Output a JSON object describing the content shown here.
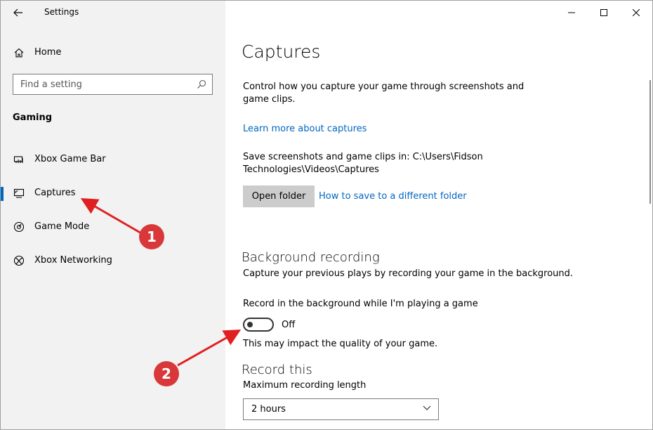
{
  "titlebar": {
    "app_title": "Settings"
  },
  "sidebar": {
    "home_label": "Home",
    "search_placeholder": "Find a setting",
    "section_title": "Gaming",
    "items": [
      {
        "label": "Xbox Game Bar",
        "icon": "xbox-game-bar-icon"
      },
      {
        "label": "Captures",
        "icon": "captures-icon",
        "active": true
      },
      {
        "label": "Game Mode",
        "icon": "game-mode-icon"
      },
      {
        "label": "Xbox Networking",
        "icon": "xbox-icon"
      }
    ]
  },
  "main": {
    "title": "Captures",
    "description": "Control how you capture your game through screenshots and game clips.",
    "learn_more_link": "Learn more about captures",
    "save_path_text": "Save screenshots and game clips in: C:\\Users\\Fidson Technologies\\Videos\\Captures",
    "open_folder_label": "Open folder",
    "how_to_link": "How to save to a different folder",
    "background_recording": {
      "title": "Background recording",
      "description": "Capture your previous plays by recording your game in the background.",
      "toggle_label": "Record in the background while I'm playing a game",
      "toggle_state": "Off",
      "impact_note": "This may impact the quality of your game."
    },
    "record_this": {
      "title": "Record this",
      "max_length_label": "Maximum recording length",
      "max_length_value": "2 hours"
    }
  },
  "annotations": [
    {
      "number": "1",
      "color": "#d9383a"
    },
    {
      "number": "2",
      "color": "#d9383a"
    }
  ],
  "colors": {
    "accent": "#0067c0",
    "sidebar_bg": "#f2f2f2",
    "annotation": "#d9383a"
  }
}
